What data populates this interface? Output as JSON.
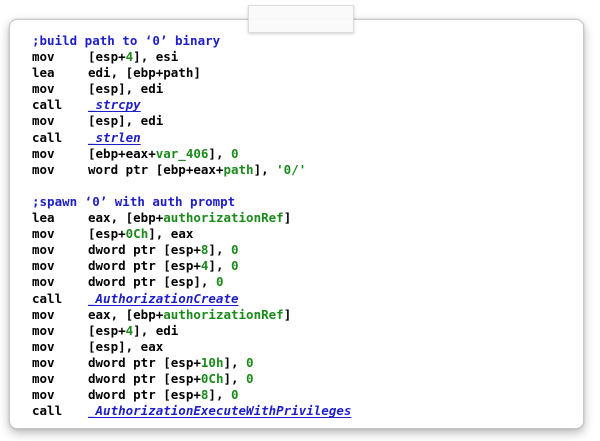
{
  "blocks": [
    {
      "comment": ";build path to ‘0’ binary",
      "lines": [
        {
          "mnemonic": "mov",
          "parts": [
            {
              "t": "t",
              "v": "[esp+"
            },
            {
              "t": "n",
              "v": "4"
            },
            {
              "t": "t",
              "v": "], esi"
            }
          ]
        },
        {
          "mnemonic": "lea",
          "parts": [
            {
              "t": "t",
              "v": "edi, [ebp+path]"
            }
          ]
        },
        {
          "mnemonic": "mov",
          "parts": [
            {
              "t": "t",
              "v": "[esp], edi"
            }
          ]
        },
        {
          "mnemonic": "call",
          "parts": [
            {
              "t": "f",
              "v": "_strcpy"
            }
          ]
        },
        {
          "mnemonic": "mov",
          "parts": [
            {
              "t": "t",
              "v": "[esp], edi"
            }
          ]
        },
        {
          "mnemonic": "call",
          "parts": [
            {
              "t": "f",
              "v": "_strlen"
            }
          ]
        },
        {
          "mnemonic": "mov",
          "parts": [
            {
              "t": "t",
              "v": "[ebp+eax+"
            },
            {
              "t": "v",
              "v": "var_406"
            },
            {
              "t": "t",
              "v": "], "
            },
            {
              "t": "n",
              "v": "0"
            }
          ]
        },
        {
          "mnemonic": "mov",
          "parts": [
            {
              "t": "t",
              "v": "word ptr [ebp+eax+"
            },
            {
              "t": "v",
              "v": "path"
            },
            {
              "t": "t",
              "v": "], "
            },
            {
              "t": "s",
              "v": "'0/'"
            }
          ]
        }
      ]
    },
    {
      "comment": ";spawn ‘0’ with auth prompt",
      "lines": [
        {
          "mnemonic": "lea",
          "parts": [
            {
              "t": "t",
              "v": "eax, [ebp+"
            },
            {
              "t": "v",
              "v": "authorizationRef"
            },
            {
              "t": "t",
              "v": "]"
            }
          ]
        },
        {
          "mnemonic": "mov",
          "parts": [
            {
              "t": "t",
              "v": "[esp+"
            },
            {
              "t": "n",
              "v": "0Ch"
            },
            {
              "t": "t",
              "v": "], eax"
            }
          ]
        },
        {
          "mnemonic": "mov",
          "parts": [
            {
              "t": "t",
              "v": "dword ptr [esp+"
            },
            {
              "t": "n",
              "v": "8"
            },
            {
              "t": "t",
              "v": "], "
            },
            {
              "t": "n",
              "v": "0"
            }
          ]
        },
        {
          "mnemonic": "mov",
          "parts": [
            {
              "t": "t",
              "v": "dword ptr [esp+"
            },
            {
              "t": "n",
              "v": "4"
            },
            {
              "t": "t",
              "v": "], "
            },
            {
              "t": "n",
              "v": "0"
            }
          ]
        },
        {
          "mnemonic": "mov",
          "parts": [
            {
              "t": "t",
              "v": "dword ptr [esp], "
            },
            {
              "t": "n",
              "v": "0"
            }
          ]
        },
        {
          "mnemonic": "call",
          "parts": [
            {
              "t": "f",
              "v": "_AuthorizationCreate"
            }
          ]
        },
        {
          "mnemonic": "mov",
          "parts": [
            {
              "t": "t",
              "v": "eax, [ebp+"
            },
            {
              "t": "v",
              "v": "authorizationRef"
            },
            {
              "t": "t",
              "v": "]"
            }
          ]
        },
        {
          "mnemonic": "mov",
          "parts": [
            {
              "t": "t",
              "v": "[esp+"
            },
            {
              "t": "n",
              "v": "4"
            },
            {
              "t": "t",
              "v": "], edi"
            }
          ]
        },
        {
          "mnemonic": "mov",
          "parts": [
            {
              "t": "t",
              "v": "[esp], eax"
            }
          ]
        },
        {
          "mnemonic": "mov",
          "parts": [
            {
              "t": "t",
              "v": "dword ptr [esp+"
            },
            {
              "t": "n",
              "v": "10h"
            },
            {
              "t": "t",
              "v": "], "
            },
            {
              "t": "n",
              "v": "0"
            }
          ]
        },
        {
          "mnemonic": "mov",
          "parts": [
            {
              "t": "t",
              "v": "dword ptr [esp+"
            },
            {
              "t": "n",
              "v": "0Ch"
            },
            {
              "t": "t",
              "v": "], "
            },
            {
              "t": "n",
              "v": "0"
            }
          ]
        },
        {
          "mnemonic": "mov",
          "parts": [
            {
              "t": "t",
              "v": "dword ptr [esp+"
            },
            {
              "t": "n",
              "v": "8"
            },
            {
              "t": "t",
              "v": "], "
            },
            {
              "t": "n",
              "v": "0"
            }
          ]
        },
        {
          "mnemonic": "call",
          "parts": [
            {
              "t": "f",
              "v": "_AuthorizationExecuteWithPrivileges"
            }
          ]
        }
      ]
    }
  ],
  "colors": {
    "comment": "#1e1ec8",
    "function": "#1e1ec8",
    "number": "#1a8a1a",
    "variable": "#1a8a1a",
    "string": "#1a8a1a",
    "text": "#000000"
  }
}
